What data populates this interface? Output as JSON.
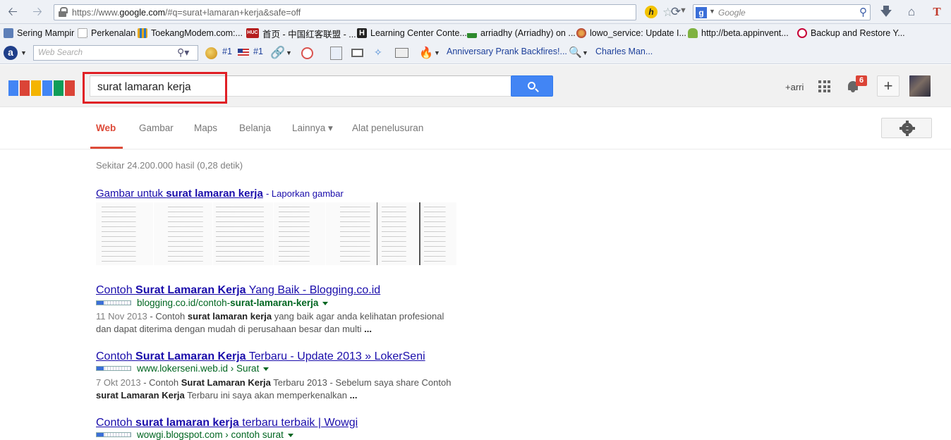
{
  "browser": {
    "url_prefix": "https://www.",
    "url_domain": "google.com",
    "url_rest": "/#q=surat+lamaran+kerja&safe=off",
    "search_placeholder": "Google"
  },
  "bookmarks": [
    {
      "label": "Sering Mampir",
      "icon": "bookmark-icon",
      "color": "#5d7fb8"
    },
    {
      "label": "Perkenalan",
      "icon": "dotted-page-icon",
      "color": "#ffffff"
    },
    {
      "label": "ToekangModem.com:...",
      "icon": "grid-icon",
      "color": "#e6a619"
    },
    {
      "label": "首页 - 中国红客联盟 - ...",
      "icon": "huc-icon",
      "color": "#b51e1e"
    },
    {
      "label": "Learning Center Conte...",
      "icon": "h-icon",
      "color": "#222222"
    },
    {
      "label": "arriadhy (Arriadhy) on ...",
      "icon": "flag-icon",
      "color": "#2d8a2d"
    },
    {
      "label": "lowo_service: Update I...",
      "icon": "globe-icon",
      "color": "#b03a2e"
    },
    {
      "label": "http://beta.appinvent...",
      "icon": "android-icon",
      "color": "#7fb241"
    },
    {
      "label": "Backup and Restore Y...",
      "icon": "debian-icon",
      "color": "#c70036"
    }
  ],
  "addon_toolbar": {
    "web_search_placeholder": "Web Search",
    "rank1": "#1",
    "rank2": "#1",
    "link1": "Anniversary Prank Backfires!...",
    "link2": "Charles Man..."
  },
  "google": {
    "query": "surat lamaran kerja",
    "user": "+arri",
    "notification_count": "6",
    "share_label": "+"
  },
  "tabs": [
    {
      "label": "Web",
      "active": true
    },
    {
      "label": "Gambar",
      "active": false
    },
    {
      "label": "Maps",
      "active": false
    },
    {
      "label": "Belanja",
      "active": false
    },
    {
      "label": "Lainnya ▾",
      "active": false
    },
    {
      "label": "Alat penelusuran",
      "active": false
    }
  ],
  "results_stats": "Sekitar 24.200.000 hasil (0,28 detik)",
  "image_block": {
    "title_prefix": "Gambar untuk ",
    "title_bold": "surat lamaran kerja",
    "report": "- Laporkan gambar",
    "thumb_count": 7
  },
  "results": [
    {
      "title_pre": "Contoh ",
      "title_bold": "Surat Lamaran Kerja",
      "title_post": " Yang Baik - Blogging.co.id",
      "url_pre": "blogging.co.id/contoh-",
      "url_bold": "surat-lamaran-kerja",
      "url_post": "",
      "date": "11 Nov 2013",
      "snip1_pre": " - Contoh ",
      "snip1_bold": "surat lamaran kerja",
      "snip1_post": " yang baik agar anda kelihatan profesional",
      "snip2": "dan dapat diterima dengan mudah di perusahaan besar dan multi ",
      "snip2_bold": "..."
    },
    {
      "title_pre": "Contoh ",
      "title_bold": "Surat Lamaran Kerja",
      "title_post": " Terbaru - Update 2013 » LokerSeni",
      "url_pre": "www.lokerseni.web.id › Surat",
      "url_bold": "",
      "url_post": "",
      "date": "7 Okt 2013",
      "snip1_pre": " - Contoh ",
      "snip1_bold": "Surat Lamaran Kerja",
      "snip1_post": " Terbaru 2013 - Sebelum saya share Contoh",
      "snip2_boldlead": "surat Lamaran Kerja",
      "snip2": " Terbaru ini saya akan memperkenalkan ",
      "snip2_bold": "..."
    },
    {
      "title_pre": "Contoh ",
      "title_bold": "surat lamaran kerja",
      "title_post": " terbaru terbaik | Wowgi",
      "url_pre": "wowgi.blogspot.com › contoh surat",
      "url_bold": "",
      "url_post": ""
    }
  ]
}
